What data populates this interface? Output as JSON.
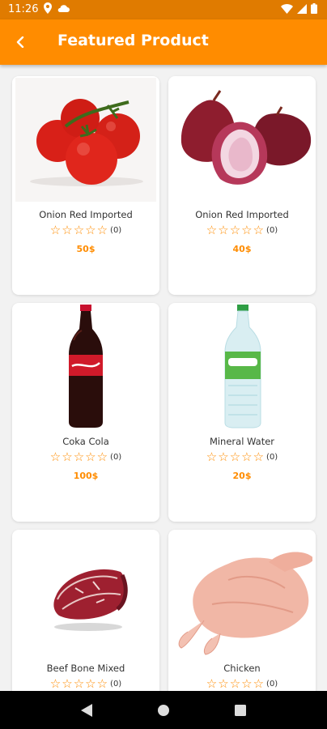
{
  "status_bar": {
    "time": "11:26",
    "icons_left": [
      "location-icon",
      "cloud-icon"
    ],
    "icons_right": [
      "wifi-icon",
      "signal-icon",
      "battery-icon"
    ],
    "bg_color": "#e07b00"
  },
  "app_bar": {
    "title": "Featured Product",
    "back_icon": "arrow-back-icon",
    "bg_color": "#ff8c00"
  },
  "products": [
    {
      "name": "Onion Red Imported",
      "rating_count": "(0)",
      "price": "50$",
      "image": "tomatoes"
    },
    {
      "name": "Onion Red Imported",
      "rating_count": "(0)",
      "price": "40$",
      "image": "red-onions"
    },
    {
      "name": "Coka Cola",
      "rating_count": "(0)",
      "price": "100$",
      "image": "cola-bottle"
    },
    {
      "name": "Mineral Water",
      "rating_count": "(0)",
      "price": "20$",
      "image": "water-bottle"
    },
    {
      "name": "Beef Bone Mixed",
      "rating_count": "(0)",
      "price": "",
      "image": "beef-steak"
    },
    {
      "name": "Chicken",
      "rating_count": "(0)",
      "price": "",
      "image": "raw-chicken"
    }
  ],
  "star_glyph": "☆",
  "accent_color": "#ff8c00",
  "nav_bar": {
    "buttons": [
      "back-triangle-icon",
      "home-circle-icon",
      "recents-square-icon"
    ]
  }
}
